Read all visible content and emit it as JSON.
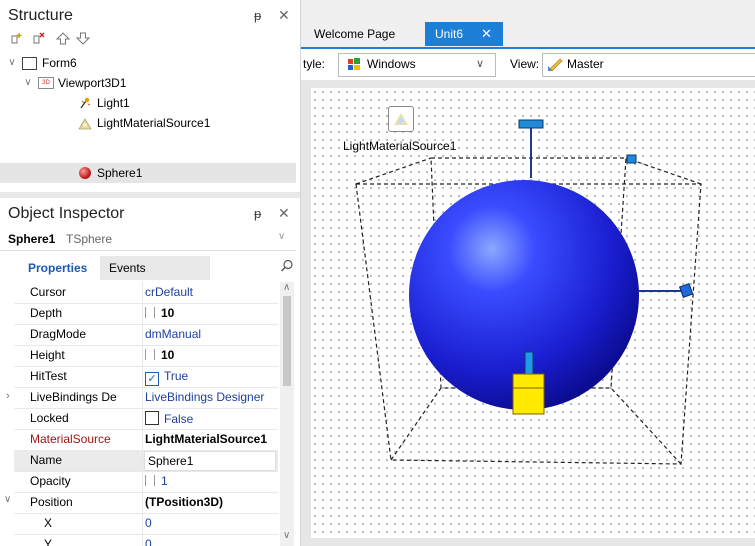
{
  "structure": {
    "title": "Structure",
    "tree": [
      {
        "label": "Form6",
        "level": 0
      },
      {
        "label": "Viewport3D1",
        "level": 1
      },
      {
        "label": "Light1",
        "level": 2
      },
      {
        "label": "LightMaterialSource1",
        "level": 2
      },
      {
        "label": "Sphere1",
        "level": 2
      }
    ]
  },
  "inspector": {
    "title": "Object Inspector",
    "object_name": "Sphere1",
    "object_type": "TSphere",
    "tabs": [
      "Properties",
      "Events"
    ],
    "rows": [
      {
        "name": "Cursor",
        "value": "crDefault"
      },
      {
        "name": "Depth",
        "value": "10"
      },
      {
        "name": "DragMode",
        "value": "dmManual"
      },
      {
        "name": "Height",
        "value": "10"
      },
      {
        "name": "HitTest",
        "value": "True"
      },
      {
        "name": "LiveBindings De",
        "value": "LiveBindings Designer"
      },
      {
        "name": "Locked",
        "value": "False"
      },
      {
        "name": "MaterialSource",
        "value": "LightMaterialSource1"
      },
      {
        "name": "Name",
        "value": "Sphere1"
      },
      {
        "name": "Opacity",
        "value": "1"
      },
      {
        "name": "Position",
        "value": "(TPosition3D)"
      },
      {
        "name": "X",
        "value": "0"
      },
      {
        "name": "Y",
        "value": "0"
      }
    ]
  },
  "editor": {
    "tabs": [
      "Welcome Page",
      "Unit6"
    ],
    "style_label": "tyle:",
    "style_value": "Windows",
    "view_label": "View:",
    "view_value": "Master",
    "component_label": "LightMaterialSource1"
  },
  "colors": {
    "accent": "#1e7fd6",
    "sphere": "#2a2ad8",
    "material_source_text": "#a01515"
  }
}
